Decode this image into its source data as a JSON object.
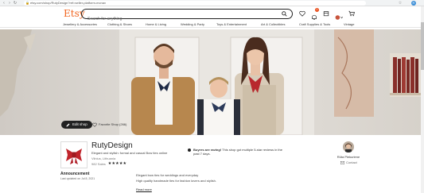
{
  "browser": {
    "url": "etsy.com/shop/RutyDesign?ref=seller-platform-mcnav"
  },
  "header": {
    "logo": "Etsy",
    "search_placeholder": "Search for anything",
    "cart_badge": "1"
  },
  "categories": [
    "Jewellery & Accessories",
    "Clothing & Shoes",
    "Home & Living",
    "Wedding & Party",
    "Toys & Entertainment",
    "Art & Collectibles",
    "Craft Supplies & Tools",
    "Vintage"
  ],
  "banner": {
    "edit_label": "Edit shop",
    "favourite_label": "Favorite Shop (266)"
  },
  "shop": {
    "name": "RutyDesign",
    "description": "Elegant and stylish: formal and casual Bow ties online",
    "location": "Vilnius, Lithuania",
    "sales": "982 Sales",
    "stars": "★★★★★",
    "notice_bold": "Buyers are raving!",
    "notice_text": " This shop got multiple 5-star reviews in the past 7 days.",
    "owner_name": "Rūta Piekuriene",
    "contact_label": "Contact"
  },
  "announcement": {
    "title": "Announcement",
    "date": "Last updated on Jul 8, 2021",
    "line1": "Elegant bow ties for weddings and everyday",
    "line2": "High quality handmade ties for fashion lovers and stylish.",
    "read_more": "Read more"
  },
  "colors": {
    "brand": "#f1641e",
    "badge": "#e94e1b"
  }
}
